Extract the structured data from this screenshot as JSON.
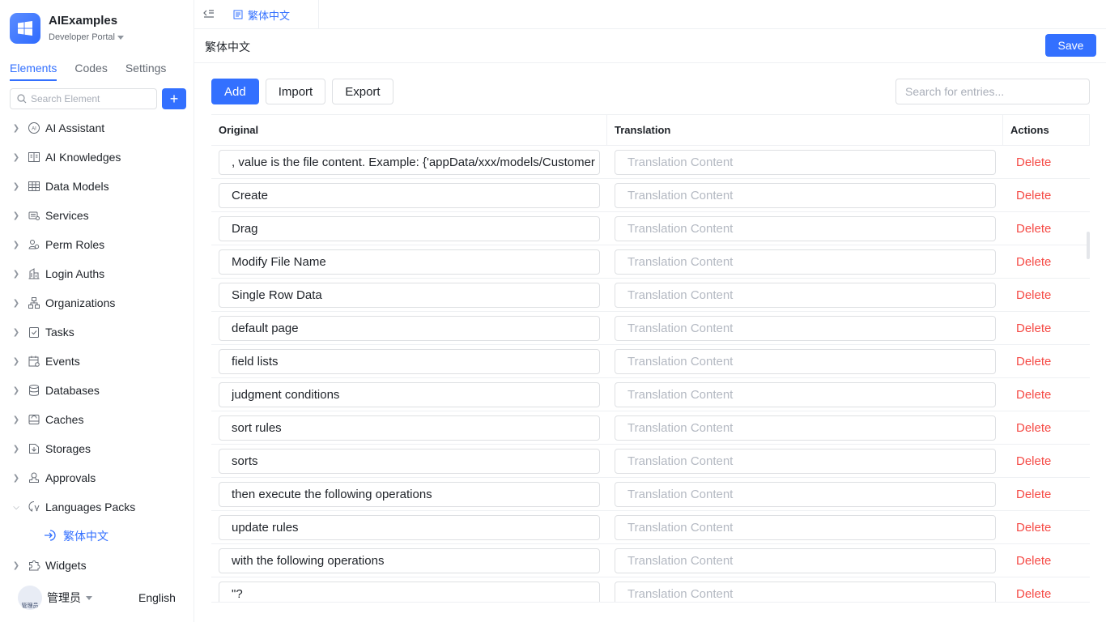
{
  "app": {
    "title": "AIExamples",
    "subtitle": "Developer Portal"
  },
  "sidebar": {
    "tabs": [
      {
        "label": "Elements"
      },
      {
        "label": "Codes"
      },
      {
        "label": "Settings"
      }
    ],
    "search_placeholder": "Search Element",
    "add_label": "+",
    "items": [
      {
        "label": "AI Assistant",
        "icon": "ai-icon"
      },
      {
        "label": "AI Knowledges",
        "icon": "book-icon"
      },
      {
        "label": "Data Models",
        "icon": "table-icon"
      },
      {
        "label": "Services",
        "icon": "services-icon"
      },
      {
        "label": "Perm Roles",
        "icon": "users-icon"
      },
      {
        "label": "Login Auths",
        "icon": "building-icon"
      },
      {
        "label": "Organizations",
        "icon": "org-icon"
      },
      {
        "label": "Tasks",
        "icon": "clipboard-check-icon"
      },
      {
        "label": "Events",
        "icon": "calendar-icon"
      },
      {
        "label": "Databases",
        "icon": "database-icon"
      },
      {
        "label": "Caches",
        "icon": "cache-icon"
      },
      {
        "label": "Storages",
        "icon": "storage-icon"
      },
      {
        "label": "Approvals",
        "icon": "approval-icon"
      },
      {
        "label": "Languages Packs",
        "icon": "language-icon",
        "expanded": true
      },
      {
        "label": "Widgets",
        "icon": "puzzle-icon"
      }
    ],
    "sub_item": {
      "label": "繁体中文",
      "icon": "enter-icon"
    }
  },
  "user": {
    "name": "管理员",
    "avatar_text": "管理员",
    "language": "English"
  },
  "tabbar": {
    "active_tab": "繁体中文"
  },
  "page": {
    "title": "繁体中文",
    "save_label": "Save"
  },
  "toolbar": {
    "add_label": "Add",
    "import_label": "Import",
    "export_label": "Export",
    "search_placeholder": "Search for entries..."
  },
  "table": {
    "columns": [
      "Original",
      "Translation",
      "Actions"
    ],
    "translation_placeholder": "Translation Content",
    "delete_label": "Delete",
    "rows": [
      {
        "original": ", value is the file content. Example: {'appData/xxx/models/Customer"
      },
      {
        "original": "Create"
      },
      {
        "original": "Drag"
      },
      {
        "original": "Modify File Name"
      },
      {
        "original": "Single Row Data"
      },
      {
        "original": "default page"
      },
      {
        "original": "field lists"
      },
      {
        "original": "judgment conditions"
      },
      {
        "original": "sort rules"
      },
      {
        "original": "sorts"
      },
      {
        "original": "then execute the following operations"
      },
      {
        "original": "update rules"
      },
      {
        "original": "with the following operations"
      },
      {
        "original": "\"?"
      }
    ]
  },
  "colors": {
    "accent": "#3370ff",
    "danger": "#f54a45",
    "border": "#dee0e3"
  }
}
